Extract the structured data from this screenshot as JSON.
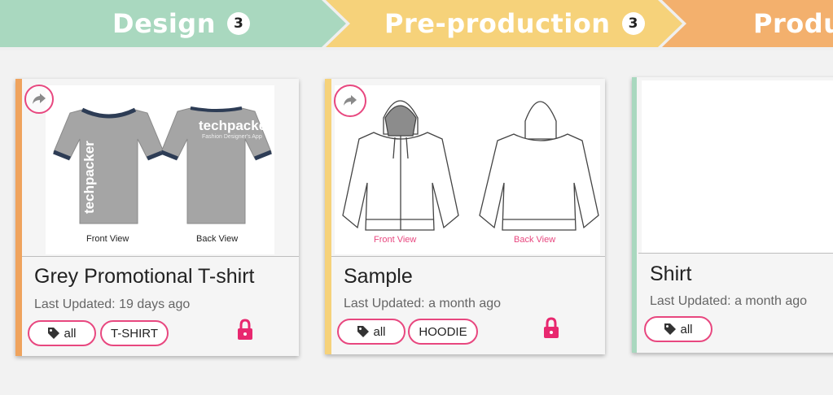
{
  "stages": [
    {
      "label": "Design",
      "count": "3",
      "color": "#a9d8bf"
    },
    {
      "label": "Pre-production",
      "count": "3",
      "color": "#f6d27a"
    },
    {
      "label": "Produ",
      "color": "#f3b06d"
    }
  ],
  "cards": [
    {
      "title": "Grey Promotional T-shirt",
      "updated": "Last Updated: 19 days ago",
      "accent": "#efa35d",
      "tags": [
        "all",
        "T-SHIRT"
      ],
      "front_caption": "Front View",
      "back_caption": "Back View",
      "brand": "techpacker",
      "brand_tagline": "Fashion Designer's App",
      "locked": true,
      "image": "grey-tshirt-flat"
    },
    {
      "title": "Sample",
      "updated": "Last Updated: a month ago",
      "accent": "#f6d27a",
      "tags": [
        "all",
        "HOODIE"
      ],
      "front_caption": "Front View",
      "back_caption": "Back View",
      "locked": true,
      "image": "hoodie-flat-sketch"
    },
    {
      "title": "Shirt",
      "updated": "Last Updated: a month ago",
      "accent": "#a9d8bf",
      "tags": [
        "all"
      ],
      "locked": false,
      "image": "blank"
    }
  ],
  "colors": {
    "tag_border": "#e8477f",
    "lock": "#e8286f"
  },
  "icons": {
    "share": "share-arrow-icon",
    "tag": "tag-icon",
    "lock": "lock-icon"
  }
}
